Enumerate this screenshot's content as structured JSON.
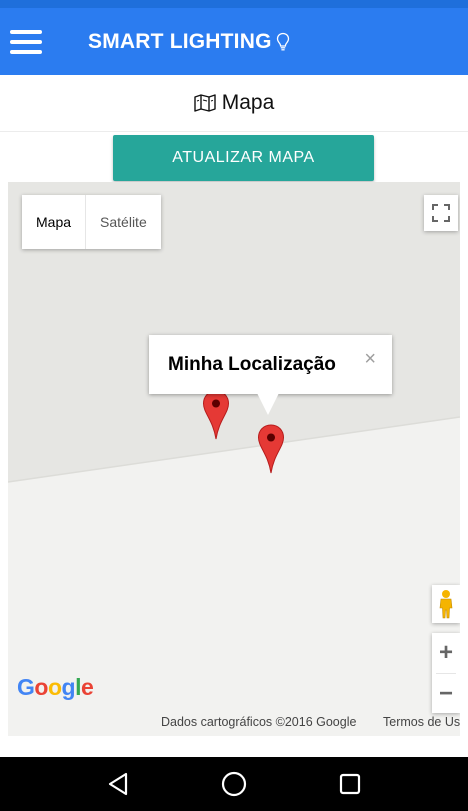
{
  "app": {
    "title": "SMART LIGHTING"
  },
  "page": {
    "title": "Mapa"
  },
  "actions": {
    "update_map": "ATUALIZAR MAPA"
  },
  "map": {
    "type_options": [
      "Mapa",
      "Satélite"
    ],
    "selected_type": "Mapa",
    "info_window_title": "Minha Localização",
    "info_window_close": "×",
    "zoom_in": "+",
    "zoom_out": "−",
    "attribution": "Dados cartográficos ©2016 Google",
    "terms": "Termos de Uso",
    "logo": {
      "G": "G",
      "o1": "o",
      "o2": "o",
      "g": "g",
      "l": "l",
      "e": "e"
    }
  },
  "colors": {
    "app_bar": "#2b7cf0",
    "button": "#26a69a",
    "pin": "#e53935"
  },
  "icons": {
    "menu": "hamburger-menu-icon",
    "bulb": "lightbulb-icon",
    "map": "map-icon",
    "fullscreen": "fullscreen-icon",
    "pegman": "street-view-pegman-icon",
    "back": "back-triangle-icon",
    "home": "home-circle-icon",
    "recents": "recents-square-icon"
  }
}
